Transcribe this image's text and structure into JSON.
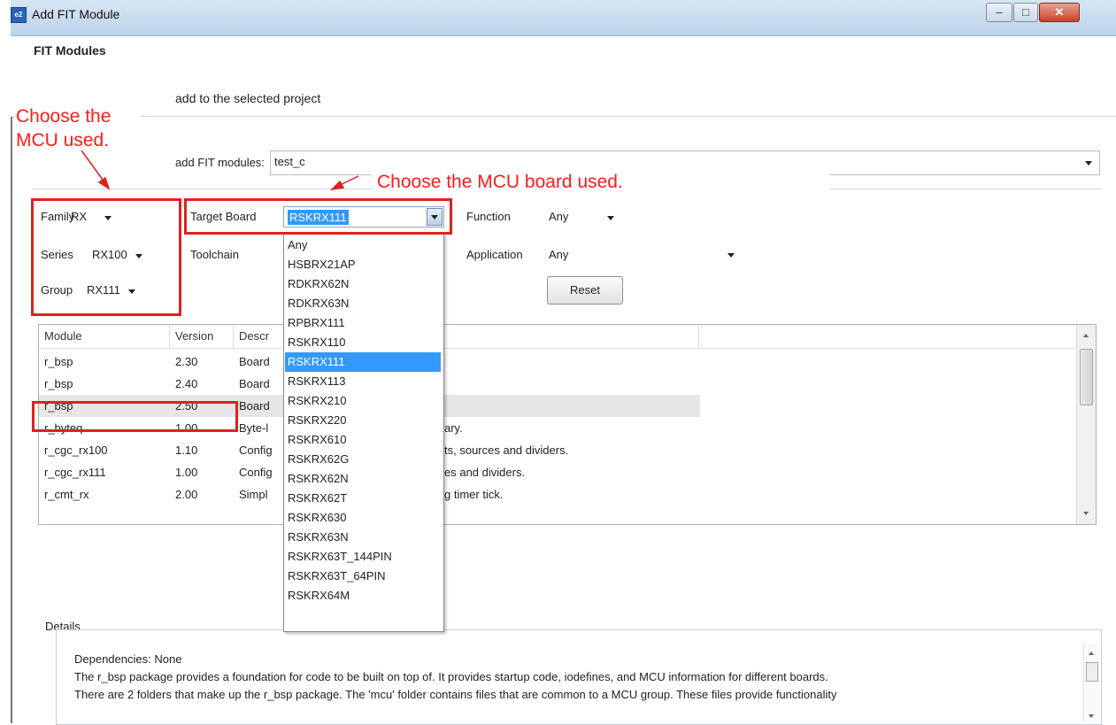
{
  "window": {
    "title": "Add FIT Module",
    "app_icon": "e2"
  },
  "header": {
    "title": "FIT Modules",
    "description": "add to the selected project"
  },
  "project": {
    "label": "add FIT modules:",
    "value": "test_c"
  },
  "filters": {
    "family": {
      "label": "Family",
      "value": "RX"
    },
    "series": {
      "label": "Series",
      "value": "RX100"
    },
    "group": {
      "label": "Group",
      "value": "RX111"
    },
    "target_board": {
      "label": "Target Board",
      "value": "RSKRX111"
    },
    "toolchain": {
      "label": "Toolchain"
    },
    "function": {
      "label": "Function",
      "value": "Any"
    },
    "application": {
      "label": "Application",
      "value": "Any"
    },
    "reset_label": "Reset"
  },
  "board_options": [
    "Any",
    "HSBRX21AP",
    "RDKRX62N",
    "RDKRX63N",
    "RPBRX111",
    "RSKRX110",
    "RSKRX111",
    "RSKRX113",
    "RSKRX210",
    "RSKRX220",
    "RSKRX610",
    "RSKRX62G",
    "RSKRX62N",
    "RSKRX62T",
    "RSKRX630",
    "RSKRX63N",
    "RSKRX63T_144PIN",
    "RSKRX63T_64PIN",
    "RSKRX64M"
  ],
  "table": {
    "columns": [
      "Module",
      "Version",
      "Descr"
    ],
    "rows": [
      {
        "module": "r_bsp",
        "version": "2.30",
        "desc": "Board"
      },
      {
        "module": "r_bsp",
        "version": "2.40",
        "desc": "Board"
      },
      {
        "module": "r_bsp",
        "version": "2.50",
        "desc": "Board"
      },
      {
        "module": "r_byteq",
        "version": "1.00",
        "desc": "Byte-l",
        "desc_tail": "ary."
      },
      {
        "module": "r_cgc_rx100",
        "version": "1.10",
        "desc": "Config",
        "desc_tail": "ts, sources and dividers."
      },
      {
        "module": "r_cgc_rx111",
        "version": "1.00",
        "desc": "Config",
        "desc_tail": "es and dividers."
      },
      {
        "module": "r_cmt_rx",
        "version": "2.00",
        "desc": "Simpl",
        "desc_tail": "g timer tick."
      }
    ]
  },
  "details": {
    "label": "Details",
    "lines": [
      "Dependencies: None",
      "The r_bsp package provides a foundation for code to be built on top of. It provides startup code, iodefines, and MCU information for different boards.",
      "There are 2 folders that make up the r_bsp package. The 'mcu' folder contains files that are common to a MCU group. These files provide functionality"
    ]
  },
  "annotations": {
    "mcu": "Choose the\nMCU used.",
    "board": "Choose the MCU board used."
  },
  "colors": {
    "highlight": "#e02020",
    "selection": "#3399ff"
  }
}
